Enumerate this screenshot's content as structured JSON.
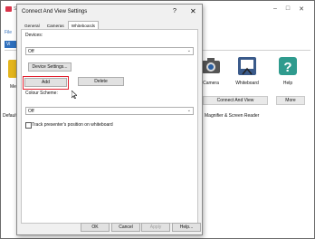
{
  "app": {
    "signature": "S",
    "menu_file": "File",
    "tab_label": "Vi",
    "ribbon": [
      {
        "label": "Camera",
        "icon": "camera-icon"
      },
      {
        "label": "Whiteboard",
        "icon": "whiteboard-icon"
      },
      {
        "label": "Help",
        "icon": "help-icon"
      }
    ],
    "me_label": "Me",
    "group_connect": "Connect And View",
    "group_more": "More",
    "status_left": "Default",
    "status_right": "Magnifier & Screen Reader",
    "win_controls": [
      "–",
      "□",
      "✕"
    ]
  },
  "dialog": {
    "title": "Connect And View Settings",
    "help_glyph": "?",
    "close_glyph": "✕",
    "tabs": [
      "General",
      "Cameras",
      "Whiteboards"
    ],
    "devices_label": "Devices:",
    "devices_value": "Off",
    "device_settings_label": "Device Settings...",
    "add_label": "Add",
    "delete_label": "Delete",
    "colour_label": "Colour Scheme:",
    "colour_value": "Off",
    "track_label": "Track presenter's position on whiteboard",
    "ok_label": "OK",
    "cancel_label": "Cancel",
    "apply_label": "Apply",
    "help_label": "Help..."
  }
}
